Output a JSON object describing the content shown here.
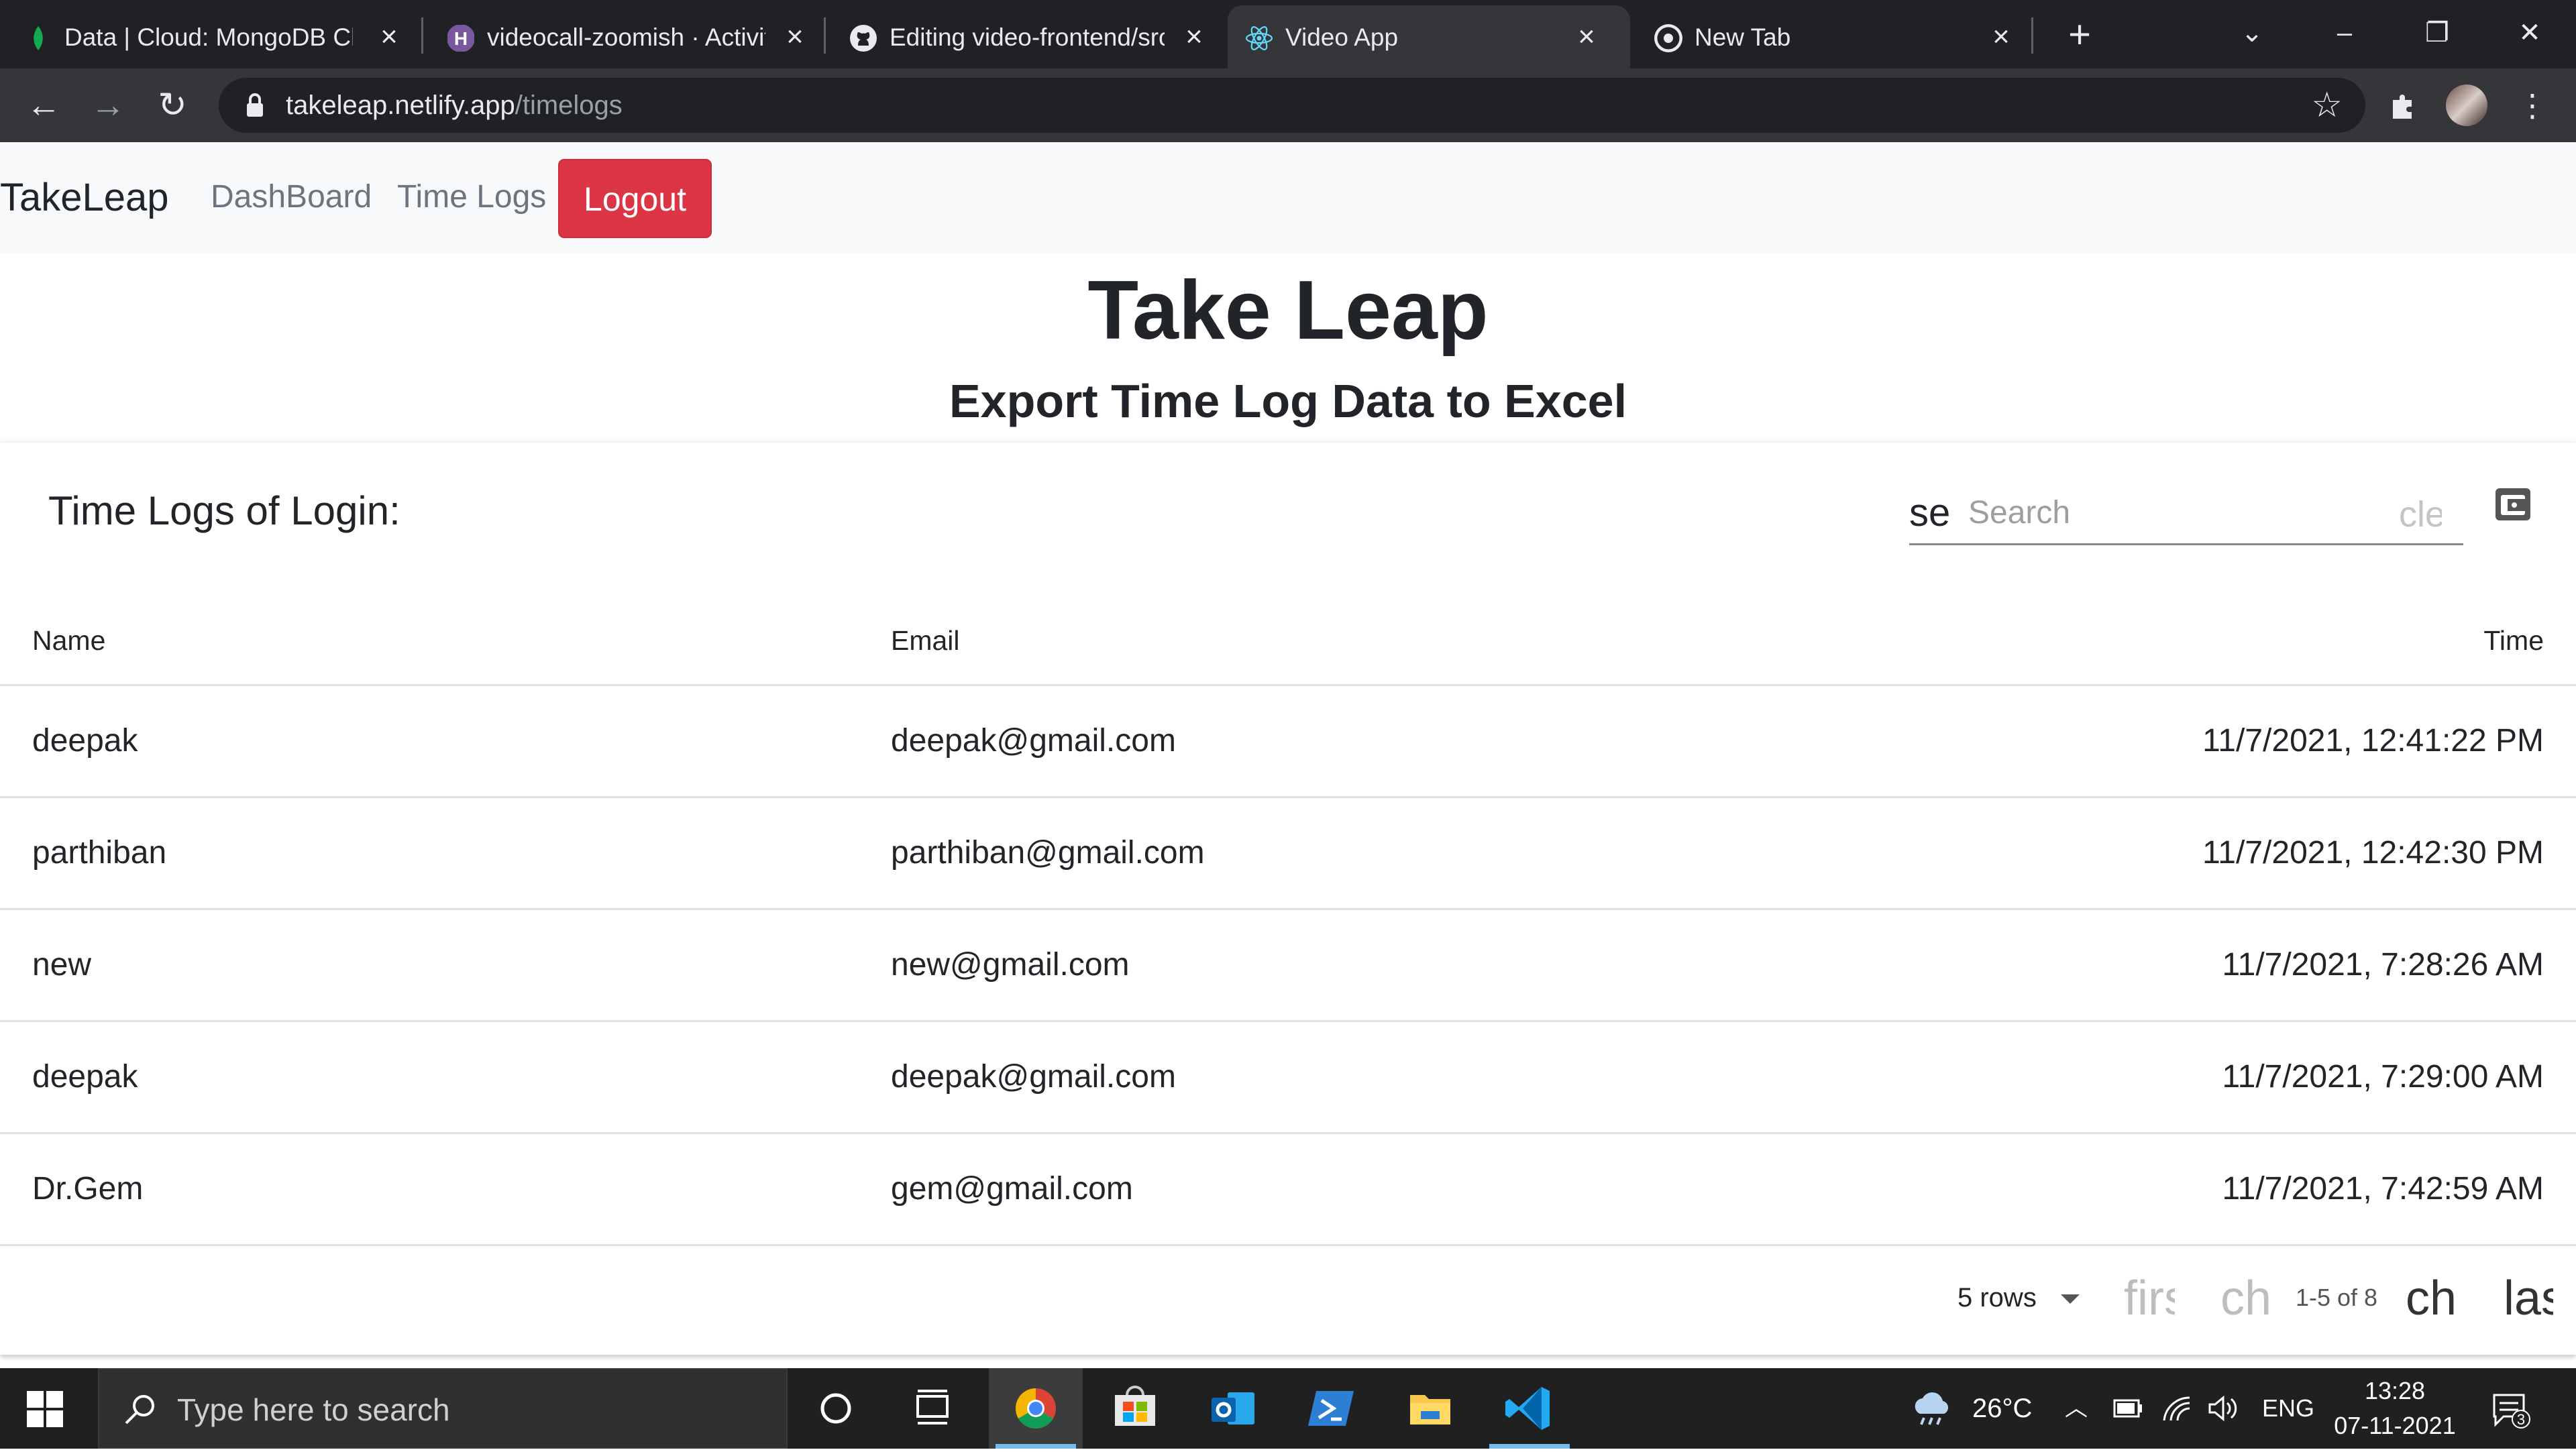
{
  "browser": {
    "tabs": [
      {
        "title": "Data | Cloud: MongoDB Cloud",
        "icon": "mongodb-leaf-icon",
        "active": false
      },
      {
        "title": "videocall-zoomish · Activity",
        "icon": "heroku-icon",
        "active": false
      },
      {
        "title": "Editing video-frontend/src",
        "icon": "github-icon",
        "active": false
      },
      {
        "title": "Video App",
        "icon": "react-icon",
        "active": true
      },
      {
        "title": "New Tab",
        "icon": "chrome-icon",
        "active": false
      }
    ],
    "url_host": "takeleap.netlify.app",
    "url_path": "/timelogs"
  },
  "navbar": {
    "brand": "TakeLeap",
    "links": [
      "DashBoard",
      "Time Logs"
    ],
    "logout_label": "Logout",
    "logout_color": "#dc3545"
  },
  "header": {
    "title": "Take Leap",
    "subtitle": "Export Time Log Data to Excel"
  },
  "table": {
    "title": "Time Logs of Login:",
    "search_icon_text": "se",
    "search_placeholder": "Search",
    "clear_icon_text": "clear",
    "export_icon": "save-alt-icon",
    "columns": [
      "Name",
      "Email",
      "Time"
    ],
    "rows": [
      {
        "name": "deepak",
        "email": "deepak@gmail.com",
        "time": "11/7/2021, 12:41:22 PM"
      },
      {
        "name": "parthiban",
        "email": "parthiban@gmail.com",
        "time": "11/7/2021, 12:42:30 PM"
      },
      {
        "name": "new",
        "email": "new@gmail.com",
        "time": "11/7/2021, 7:28:26 AM"
      },
      {
        "name": "deepak",
        "email": "deepak@gmail.com",
        "time": "11/7/2021, 7:29:00 AM"
      },
      {
        "name": "Dr.Gem",
        "email": "gem@gmail.com",
        "time": "11/7/2021, 7:42:59 AM"
      }
    ],
    "pagination": {
      "rows_per_page": "5 rows",
      "first": "first_page",
      "prev": "chevron_left",
      "info": "1-5 of 8",
      "next": "chevron_right",
      "last": "last_page"
    }
  },
  "taskbar": {
    "search_placeholder": "Type here to search",
    "weather": "26°C",
    "language": "ENG",
    "time": "13:28",
    "date": "07-11-2021",
    "notification_count": "3"
  }
}
